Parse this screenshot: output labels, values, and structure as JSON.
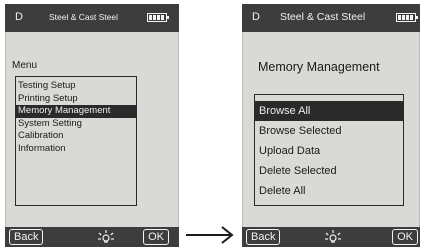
{
  "screens": [
    {
      "mode_letter": "D",
      "title": "Steel & Cast Steel",
      "menu_title": "Menu",
      "items": [
        "Testing Setup",
        "Printing Setup",
        "Memory Management",
        "System Setting",
        "Calibration",
        "Information"
      ],
      "selected_item": "Memory Management",
      "back_label": "Back",
      "ok_label": "OK"
    },
    {
      "mode_letter": "D",
      "title": "Steel & Cast Steel",
      "menu_title": "Memory Management",
      "items": [
        "Browse All",
        "Browse Selected",
        "Upload Data",
        "Delete Selected",
        "Delete All"
      ],
      "selected_item": "Browse All",
      "back_label": "Back",
      "ok_label": "OK"
    }
  ],
  "icons": {
    "battery": "battery-icon",
    "light": "backlight-icon",
    "arrow": "arrow-right-icon"
  },
  "colors": {
    "bar_background": "#3d3d3d",
    "screen_background": "#d9d9d6",
    "selection": "#2a2a2a"
  }
}
